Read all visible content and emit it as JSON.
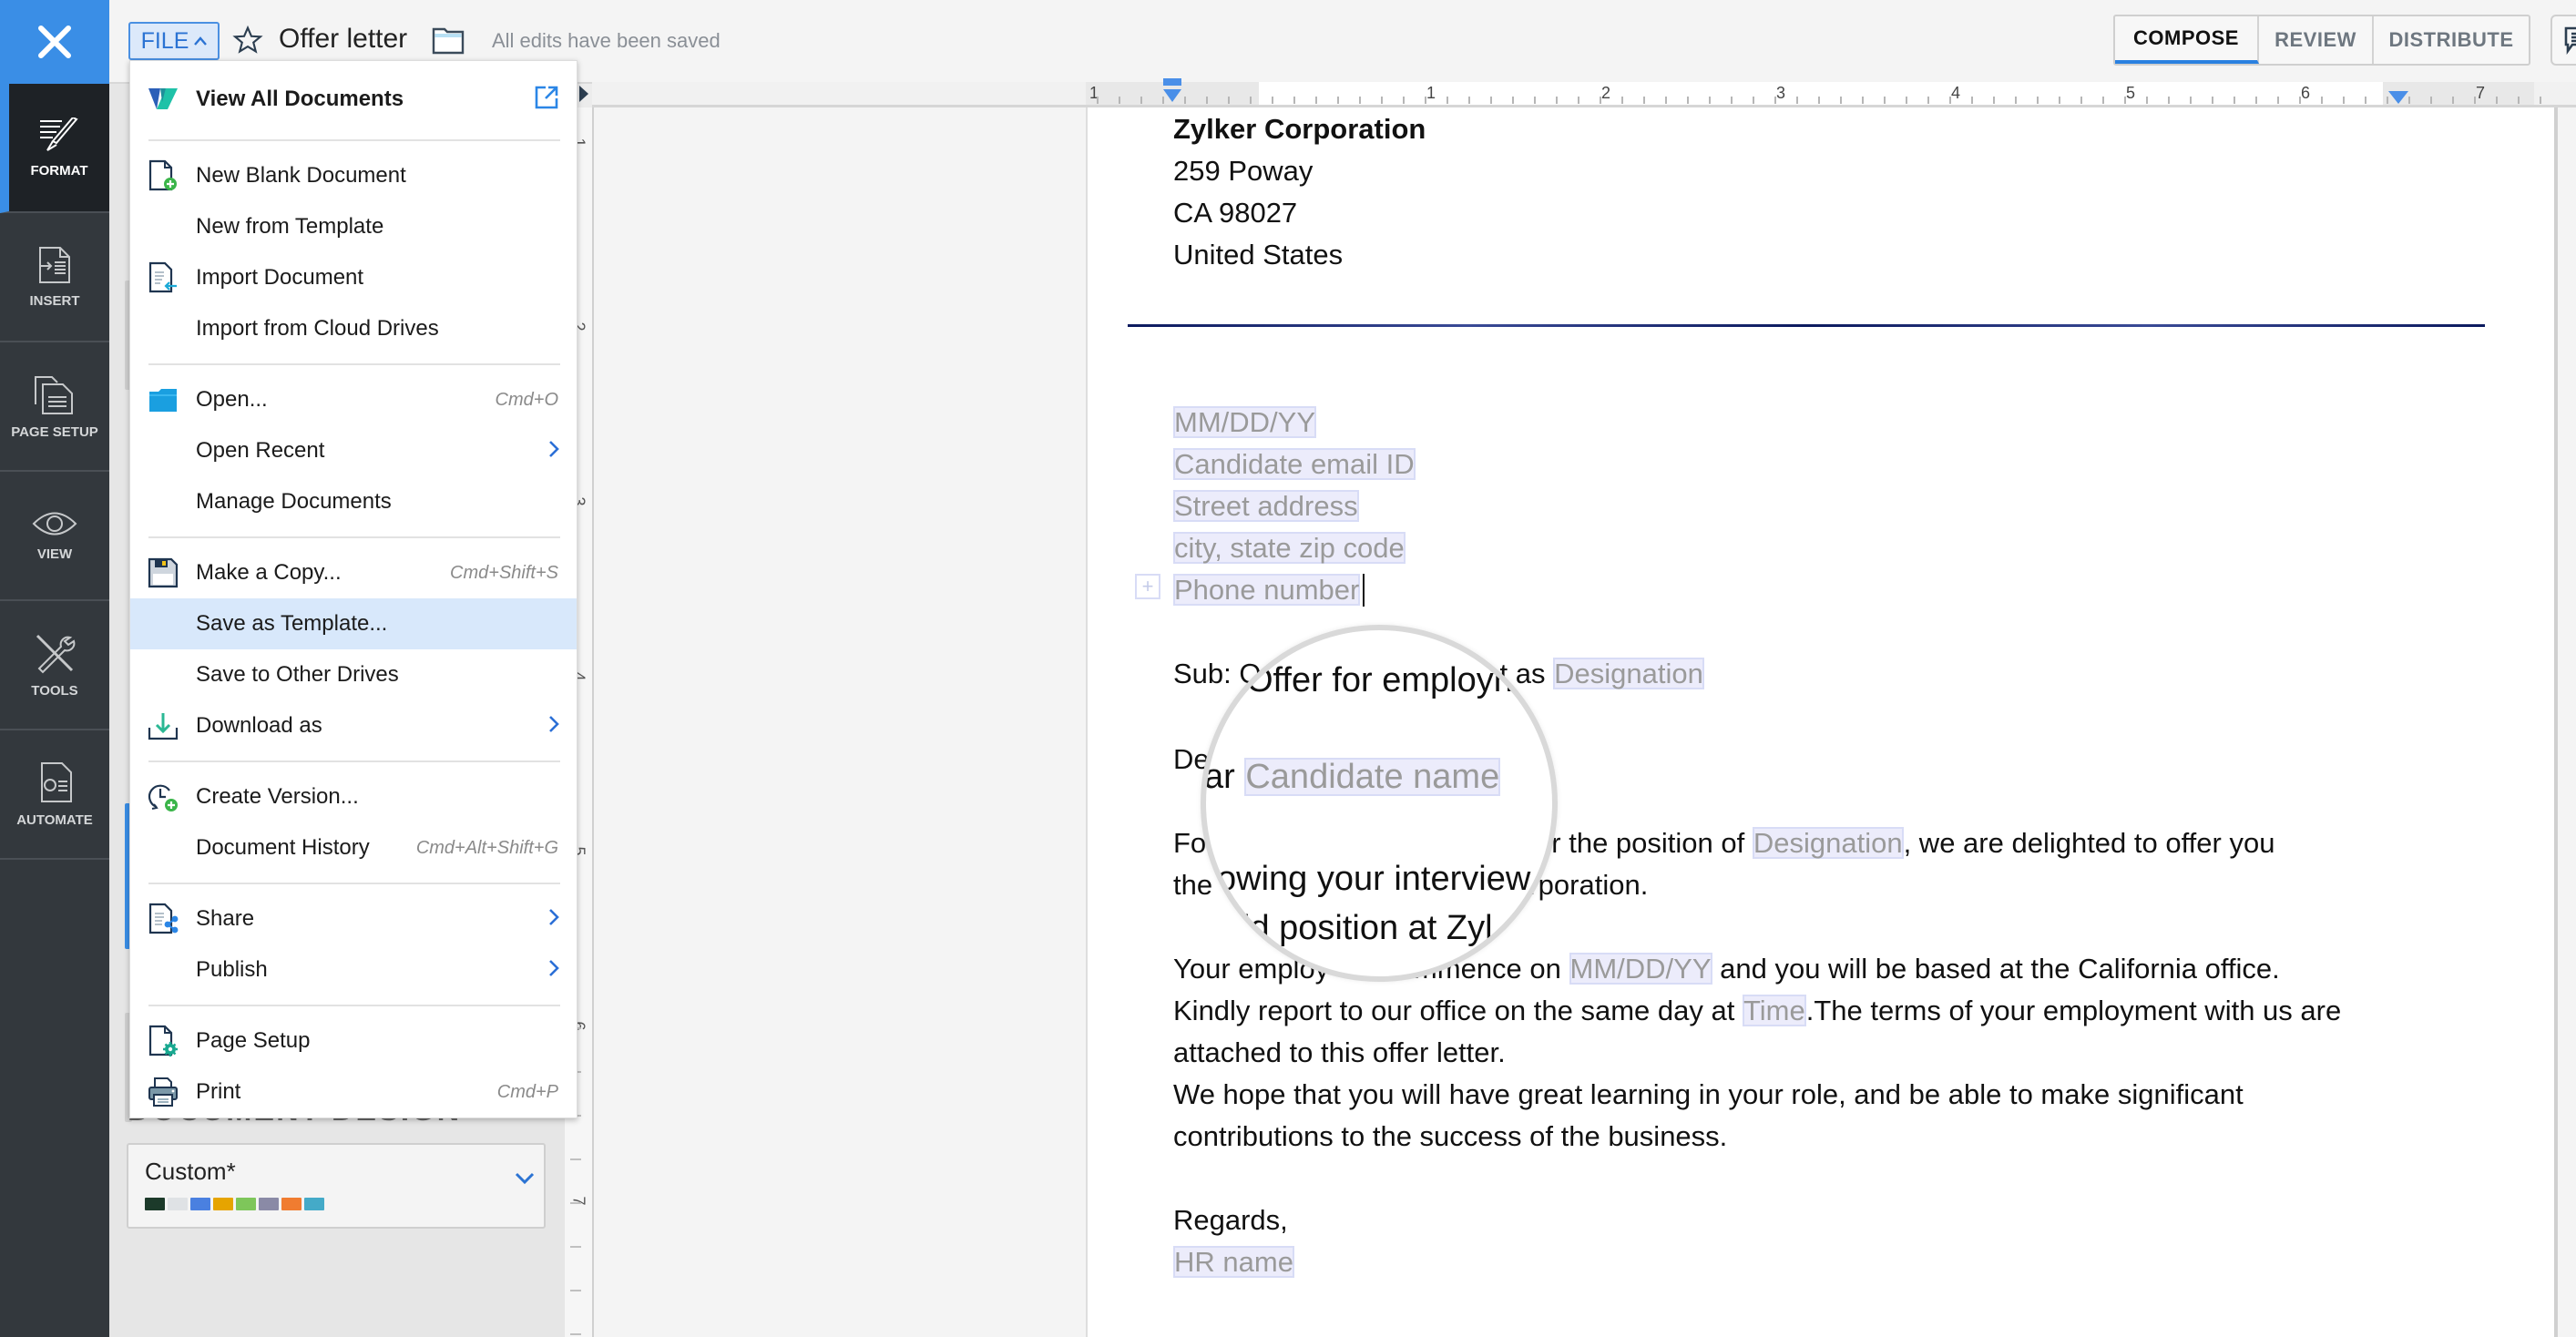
{
  "topbar": {
    "close_icon": "close-icon",
    "file_button": "FILE",
    "document_title": "Offer letter",
    "save_status": "All edits have been saved",
    "mode_tabs": [
      {
        "label": "COMPOSE",
        "active": true
      },
      {
        "label": "REVIEW",
        "active": false
      },
      {
        "label": "DISTRIBUTE",
        "active": false
      }
    ]
  },
  "leftnav": {
    "items": [
      {
        "label": "FORMAT",
        "icon": "format-brush-icon",
        "active": true
      },
      {
        "label": "INSERT",
        "icon": "insert-document-icon",
        "active": false
      },
      {
        "label": "PAGE SETUP",
        "icon": "page-setup-icon",
        "active": false
      },
      {
        "label": "VIEW",
        "icon": "eye-icon",
        "active": false
      },
      {
        "label": "TOOLS",
        "icon": "tools-icon",
        "active": false
      },
      {
        "label": "AUTOMATE",
        "icon": "automate-icon",
        "active": false
      }
    ]
  },
  "format_panel": {
    "design_heading": "DOCUMENT DESIGN",
    "design_selected": "Custom*",
    "design_swatches": [
      "#1c3a2a",
      "#dfe2e5",
      "#4a80e0",
      "#e6a400",
      "#7ec65a",
      "#8a8aa6",
      "#f07c30",
      "#44aac8"
    ]
  },
  "rulers": {
    "horizontal_labels": [
      "1",
      "1",
      "2",
      "3",
      "4",
      "5",
      "6",
      "7"
    ],
    "vertical_labels": [
      "1",
      "2",
      "3",
      "4",
      "5",
      "6",
      "7"
    ]
  },
  "file_menu": {
    "items": [
      {
        "label": "View All Documents",
        "icon": "zoho-writer-logo-icon",
        "bold": true,
        "trailing_icon": "external-link-icon"
      },
      {
        "separator": true
      },
      {
        "label": "New Blank Document",
        "icon": "new-document-icon"
      },
      {
        "label": "New from Template"
      },
      {
        "label": "Import Document",
        "icon": "import-document-icon"
      },
      {
        "label": "Import from Cloud Drives"
      },
      {
        "separator": true
      },
      {
        "label": "Open...",
        "icon": "folder-icon",
        "shortcut": "Cmd+O"
      },
      {
        "label": "Open Recent",
        "submenu": true
      },
      {
        "label": "Manage Documents"
      },
      {
        "separator": true
      },
      {
        "label": "Make a Copy...",
        "icon": "save-disk-icon",
        "shortcut": "Cmd+Shift+S"
      },
      {
        "label": "Save as Template...",
        "highlighted": true
      },
      {
        "label": "Save to Other Drives"
      },
      {
        "label": "Download as",
        "icon": "download-icon",
        "submenu": true
      },
      {
        "separator": true
      },
      {
        "label": "Create Version...",
        "icon": "create-version-icon"
      },
      {
        "label": "Document History",
        "shortcut": "Cmd+Alt+Shift+G"
      },
      {
        "separator": true
      },
      {
        "label": "Share",
        "icon": "share-icon",
        "submenu": true
      },
      {
        "label": "Publish",
        "submenu": true
      },
      {
        "separator": true
      },
      {
        "label": "Page Setup",
        "icon": "page-setup-gear-icon"
      },
      {
        "label": "Print",
        "icon": "printer-icon",
        "shortcut": "Cmd+P"
      }
    ]
  },
  "document": {
    "company_name": "Zylker Corporation",
    "address_line1": "259 Poway",
    "address_line2": "CA 98027",
    "address_line3": "United States",
    "fields": {
      "date": "MM/DD/YY",
      "email": "Candidate email ID",
      "street": "Street address",
      "city": "city, state zip code",
      "phone": "Phone number"
    },
    "subject_prefix": "Sub: O",
    "subject_mid": "t as ",
    "subject_field": "Designation",
    "dear_prefix": "De",
    "para1_prefix": "Fol",
    "para1_mid": "us for the position of ",
    "para1_field": "Designation",
    "para1_suffix": ", we are delighted to offer you",
    "para1_line2_prefix": "the",
    "para1_line2_suffix": "orporation.",
    "para2_prefix": "Your employ",
    "para2_mid": "commence on ",
    "para2_field": "MM/DD/YY",
    "para2_suffix": " and you will be based at the California office.",
    "para3_prefix": "Kindly report to our office on the same day at ",
    "para3_field": "Time",
    "para3_suffix": ".The terms of your employment with us are",
    "para3_line2": "attached to this offer letter.",
    "para4_line1": "We hope that you will have great learning in your role, and be able to make significant",
    "para4_line2": "contributions to the success of the business.",
    "closing": "Regards,",
    "signature_field": "HR name"
  },
  "magnifier": {
    "line1": "Offer for employn",
    "line2_prefix": "ar ",
    "line2_field": "Candidate name",
    "line3": "owing your interview",
    "line4": "id position at Zyl"
  }
}
